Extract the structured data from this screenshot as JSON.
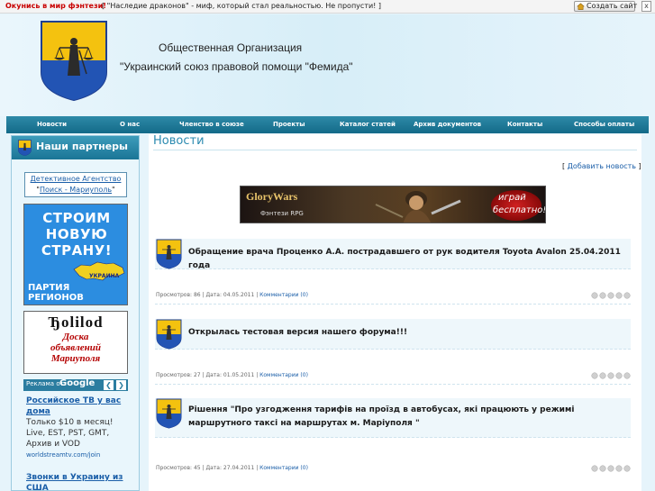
{
  "topbar": {
    "promo_link": "Окунись в мир фэнтези!",
    "promo_text": "[ \"Наследие драконов\" - миф, который стал реальностью. Не пропусти! ]",
    "create_site": "Создать сайт",
    "close": "x"
  },
  "header": {
    "org_line1": "Общественная Организация",
    "org_line2": "\"Украинский союз правовой помощи \"Фемида\""
  },
  "nav": [
    "Новости",
    "О нас",
    "Членство в союзе",
    "Проекты",
    "Каталог статей",
    "Архив документов",
    "Контакты",
    "Способы оплаты"
  ],
  "sidebar": {
    "title": "Наши партнеры",
    "detective_line1": "Детективное Агентство",
    "detective_q1": "\"",
    "detective_line2": "Поиск - Мариуполь",
    "detective_q2": "\"",
    "banner_party": {
      "slogan": [
        "СТРОИМ",
        "НОВУЮ",
        "СТРАНУ!"
      ],
      "country": "УКРАИНА",
      "party_line1": "ПАРТИЯ",
      "party_line2": "РЕГИОНОВ"
    },
    "banner_board": {
      "brand": "Ђolilod",
      "line1": "Доска",
      "line2": "объявлений",
      "line3": "Мариуполя"
    },
    "ads_label": "Реклама от",
    "ads_brand": "Google",
    "ads": [
      {
        "title": "Российское ТВ у вас дома",
        "desc": "Только $10 в месяц! Live, EST, PST, GMT, Архив и VOD",
        "url": "worldstreamtv.com/join"
      },
      {
        "title": "Звонки в Украину из США",
        "desc": "",
        "url": ""
      }
    ]
  },
  "main": {
    "page_title": "Новости",
    "add_news_open": "[",
    "add_news": "Добавить новость",
    "add_news_close": "]",
    "game_banner": {
      "name": "GloryWars",
      "subtitle": "Фэнтези RPG",
      "cta_line1": "играй",
      "cta_line2": "бесплатно!"
    },
    "posts": [
      {
        "title": "Обращение врача Проценко А.А. пострадавшего от рук водителя Toyota Avalon 25.04.2011 года",
        "views_label": "Просмотров:",
        "views": "86",
        "date_label": "Дата:",
        "date": "04.05.2011",
        "comments": "Комментарии (0)",
        "rating": 0
      },
      {
        "title": "Открылась тестовая версия нашего форума!!!",
        "views_label": "Просмотров:",
        "views": "27",
        "date_label": "Дата:",
        "date": "01.05.2011",
        "comments": "Комментарии (0)",
        "rating": 0
      },
      {
        "title": "Рішення \"Про узгодження тарифів на проїзд в автобусах, які працюють у режимі маршрутного таксі на маршрутах м. Маріуполя \"",
        "views_label": "Просмотров:",
        "views": "45",
        "date_label": "Дата:",
        "date": "27.04.2011",
        "comments": "Комментарии (0)",
        "rating": 0
      }
    ]
  },
  "colors": {
    "nav_bg": "#1a7596",
    "accent": "#2a8ab0",
    "link": "#1a5ea8",
    "emblem_yellow": "#f4c20f",
    "emblem_blue": "#2254b4"
  }
}
